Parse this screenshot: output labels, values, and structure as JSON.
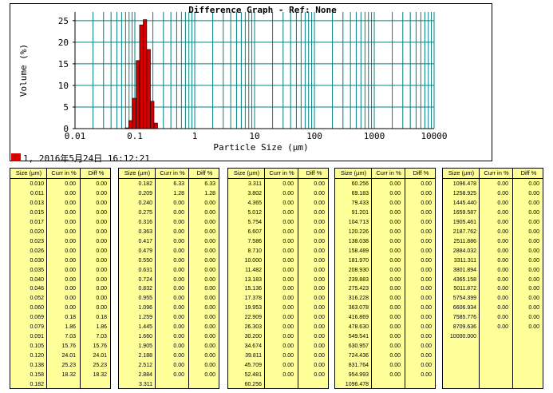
{
  "chart_data": {
    "type": "bar",
    "title": "Difference Graph - Ref: None",
    "xlabel": "Particle Size (μm)",
    "ylabel": "Volume (%)",
    "x_scale": "log",
    "xlim": [
      0.01,
      10000
    ],
    "ylim": [
      0,
      27
    ],
    "x_ticks": [
      "0.01",
      "0.1",
      "1",
      "10",
      "100",
      "1000",
      "10000"
    ],
    "y_ticks": [
      "0",
      "5",
      "10",
      "15",
      "20",
      "25"
    ],
    "grid": true,
    "bar_color": "#d40000",
    "grid_color": "#008080",
    "bins": [
      {
        "x": 0.069,
        "value": 0.18
      },
      {
        "x": 0.079,
        "value": 1.86
      },
      {
        "x": 0.091,
        "value": 7.03
      },
      {
        "x": 0.105,
        "value": 15.76
      },
      {
        "x": 0.12,
        "value": 24.01
      },
      {
        "x": 0.138,
        "value": 25.23
      },
      {
        "x": 0.158,
        "value": 18.32
      },
      {
        "x": 0.182,
        "value": 6.33
      },
      {
        "x": 0.209,
        "value": 1.28
      }
    ],
    "legend": {
      "label": "1, 2016年5月24日 16:12:21",
      "color": "#d40000",
      "position": "bottom-left"
    }
  },
  "table_headers": [
    "Size (µm)",
    "Curr in %",
    "Diff %"
  ],
  "tables": [
    {
      "rows": [
        [
          "0.010",
          "0.00",
          "0.00"
        ],
        [
          "0.011",
          "0.00",
          "0.00"
        ],
        [
          "0.013",
          "0.00",
          "0.00"
        ],
        [
          "0.015",
          "0.00",
          "0.00"
        ],
        [
          "0.017",
          "0.00",
          "0.00"
        ],
        [
          "0.020",
          "0.00",
          "0.00"
        ],
        [
          "0.023",
          "0.00",
          "0.00"
        ],
        [
          "0.026",
          "0.00",
          "0.00"
        ],
        [
          "0.030",
          "0.00",
          "0.00"
        ],
        [
          "0.035",
          "0.00",
          "0.00"
        ],
        [
          "0.040",
          "0.00",
          "0.00"
        ],
        [
          "0.046",
          "0.00",
          "0.00"
        ],
        [
          "0.052",
          "0.00",
          "0.00"
        ],
        [
          "0.060",
          "0.00",
          "0.00"
        ],
        [
          "0.069",
          "0.18",
          "0.18"
        ],
        [
          "0.079",
          "1.86",
          "1.86"
        ],
        [
          "0.091",
          "7.03",
          "7.03"
        ],
        [
          "0.105",
          "15.76",
          "15.76"
        ],
        [
          "0.120",
          "24.01",
          "24.01"
        ],
        [
          "0.138",
          "25.23",
          "25.23"
        ],
        [
          "0.158",
          "18.32",
          "18.32"
        ],
        [
          "0.182",
          "",
          ""
        ]
      ]
    },
    {
      "rows": [
        [
          "0.182",
          "6.33",
          "6.33"
        ],
        [
          "0.209",
          "1.28",
          "1.28"
        ],
        [
          "0.240",
          "0.00",
          "0.00"
        ],
        [
          "0.275",
          "0.00",
          "0.00"
        ],
        [
          "0.316",
          "0.00",
          "0.00"
        ],
        [
          "0.363",
          "0.00",
          "0.00"
        ],
        [
          "0.417",
          "0.00",
          "0.00"
        ],
        [
          "0.479",
          "0.00",
          "0.00"
        ],
        [
          "0.550",
          "0.00",
          "0.00"
        ],
        [
          "0.631",
          "0.00",
          "0.00"
        ],
        [
          "0.724",
          "0.00",
          "0.00"
        ],
        [
          "0.832",
          "0.00",
          "0.00"
        ],
        [
          "0.955",
          "0.00",
          "0.00"
        ],
        [
          "1.096",
          "0.00",
          "0.00"
        ],
        [
          "1.259",
          "0.00",
          "0.00"
        ],
        [
          "1.445",
          "0.00",
          "0.00"
        ],
        [
          "1.660",
          "0.00",
          "0.00"
        ],
        [
          "1.905",
          "0.00",
          "0.00"
        ],
        [
          "2.188",
          "0.00",
          "0.00"
        ],
        [
          "2.512",
          "0.00",
          "0.00"
        ],
        [
          "2.884",
          "0.00",
          "0.00"
        ],
        [
          "3.311",
          "",
          ""
        ]
      ]
    },
    {
      "rows": [
        [
          "3.311",
          "0.00",
          "0.00"
        ],
        [
          "3.802",
          "0.00",
          "0.00"
        ],
        [
          "4.365",
          "0.00",
          "0.00"
        ],
        [
          "5.012",
          "0.00",
          "0.00"
        ],
        [
          "5.754",
          "0.00",
          "0.00"
        ],
        [
          "6.607",
          "0.00",
          "0.00"
        ],
        [
          "7.586",
          "0.00",
          "0.00"
        ],
        [
          "8.710",
          "0.00",
          "0.00"
        ],
        [
          "10.000",
          "0.00",
          "0.00"
        ],
        [
          "11.482",
          "0.00",
          "0.00"
        ],
        [
          "13.183",
          "0.00",
          "0.00"
        ],
        [
          "15.136",
          "0.00",
          "0.00"
        ],
        [
          "17.378",
          "0.00",
          "0.00"
        ],
        [
          "19.953",
          "0.00",
          "0.00"
        ],
        [
          "22.909",
          "0.00",
          "0.00"
        ],
        [
          "26.303",
          "0.00",
          "0.00"
        ],
        [
          "30.200",
          "0.00",
          "0.00"
        ],
        [
          "34.674",
          "0.00",
          "0.00"
        ],
        [
          "39.811",
          "0.00",
          "0.00"
        ],
        [
          "45.709",
          "0.00",
          "0.00"
        ],
        [
          "52.481",
          "0.00",
          "0.00"
        ],
        [
          "60.256",
          "",
          ""
        ]
      ]
    },
    {
      "rows": [
        [
          "60.256",
          "0.00",
          "0.00"
        ],
        [
          "69.183",
          "0.00",
          "0.00"
        ],
        [
          "79.433",
          "0.00",
          "0.00"
        ],
        [
          "91.201",
          "0.00",
          "0.00"
        ],
        [
          "104.713",
          "0.00",
          "0.00"
        ],
        [
          "120.226",
          "0.00",
          "0.00"
        ],
        [
          "138.038",
          "0.00",
          "0.00"
        ],
        [
          "158.489",
          "0.00",
          "0.00"
        ],
        [
          "181.970",
          "0.00",
          "0.00"
        ],
        [
          "208.930",
          "0.00",
          "0.00"
        ],
        [
          "239.883",
          "0.00",
          "0.00"
        ],
        [
          "275.423",
          "0.00",
          "0.00"
        ],
        [
          "316.228",
          "0.00",
          "0.00"
        ],
        [
          "363.078",
          "0.00",
          "0.00"
        ],
        [
          "416.869",
          "0.00",
          "0.00"
        ],
        [
          "478.630",
          "0.00",
          "0.00"
        ],
        [
          "549.541",
          "0.00",
          "0.00"
        ],
        [
          "630.957",
          "0.00",
          "0.00"
        ],
        [
          "724.436",
          "0.00",
          "0.00"
        ],
        [
          "831.764",
          "0.00",
          "0.00"
        ],
        [
          "954.993",
          "0.00",
          "0.00"
        ],
        [
          "1096.478",
          "",
          ""
        ]
      ]
    },
    {
      "rows": [
        [
          "1096.478",
          "0.00",
          "0.00"
        ],
        [
          "1258.925",
          "0.00",
          "0.00"
        ],
        [
          "1445.440",
          "0.00",
          "0.00"
        ],
        [
          "1659.587",
          "0.00",
          "0.00"
        ],
        [
          "1905.461",
          "0.00",
          "0.00"
        ],
        [
          "2187.762",
          "0.00",
          "0.00"
        ],
        [
          "2511.886",
          "0.00",
          "0.00"
        ],
        [
          "2884.032",
          "0.00",
          "0.00"
        ],
        [
          "3311.311",
          "0.00",
          "0.00"
        ],
        [
          "3801.894",
          "0.00",
          "0.00"
        ],
        [
          "4365.158",
          "0.00",
          "0.00"
        ],
        [
          "5011.872",
          "0.00",
          "0.00"
        ],
        [
          "5754.399",
          "0.00",
          "0.00"
        ],
        [
          "6606.934",
          "0.00",
          "0.00"
        ],
        [
          "7585.776",
          "0.00",
          "0.00"
        ],
        [
          "8709.636",
          "0.00",
          "0.00"
        ],
        [
          "10000.000",
          "",
          ""
        ]
      ]
    }
  ]
}
